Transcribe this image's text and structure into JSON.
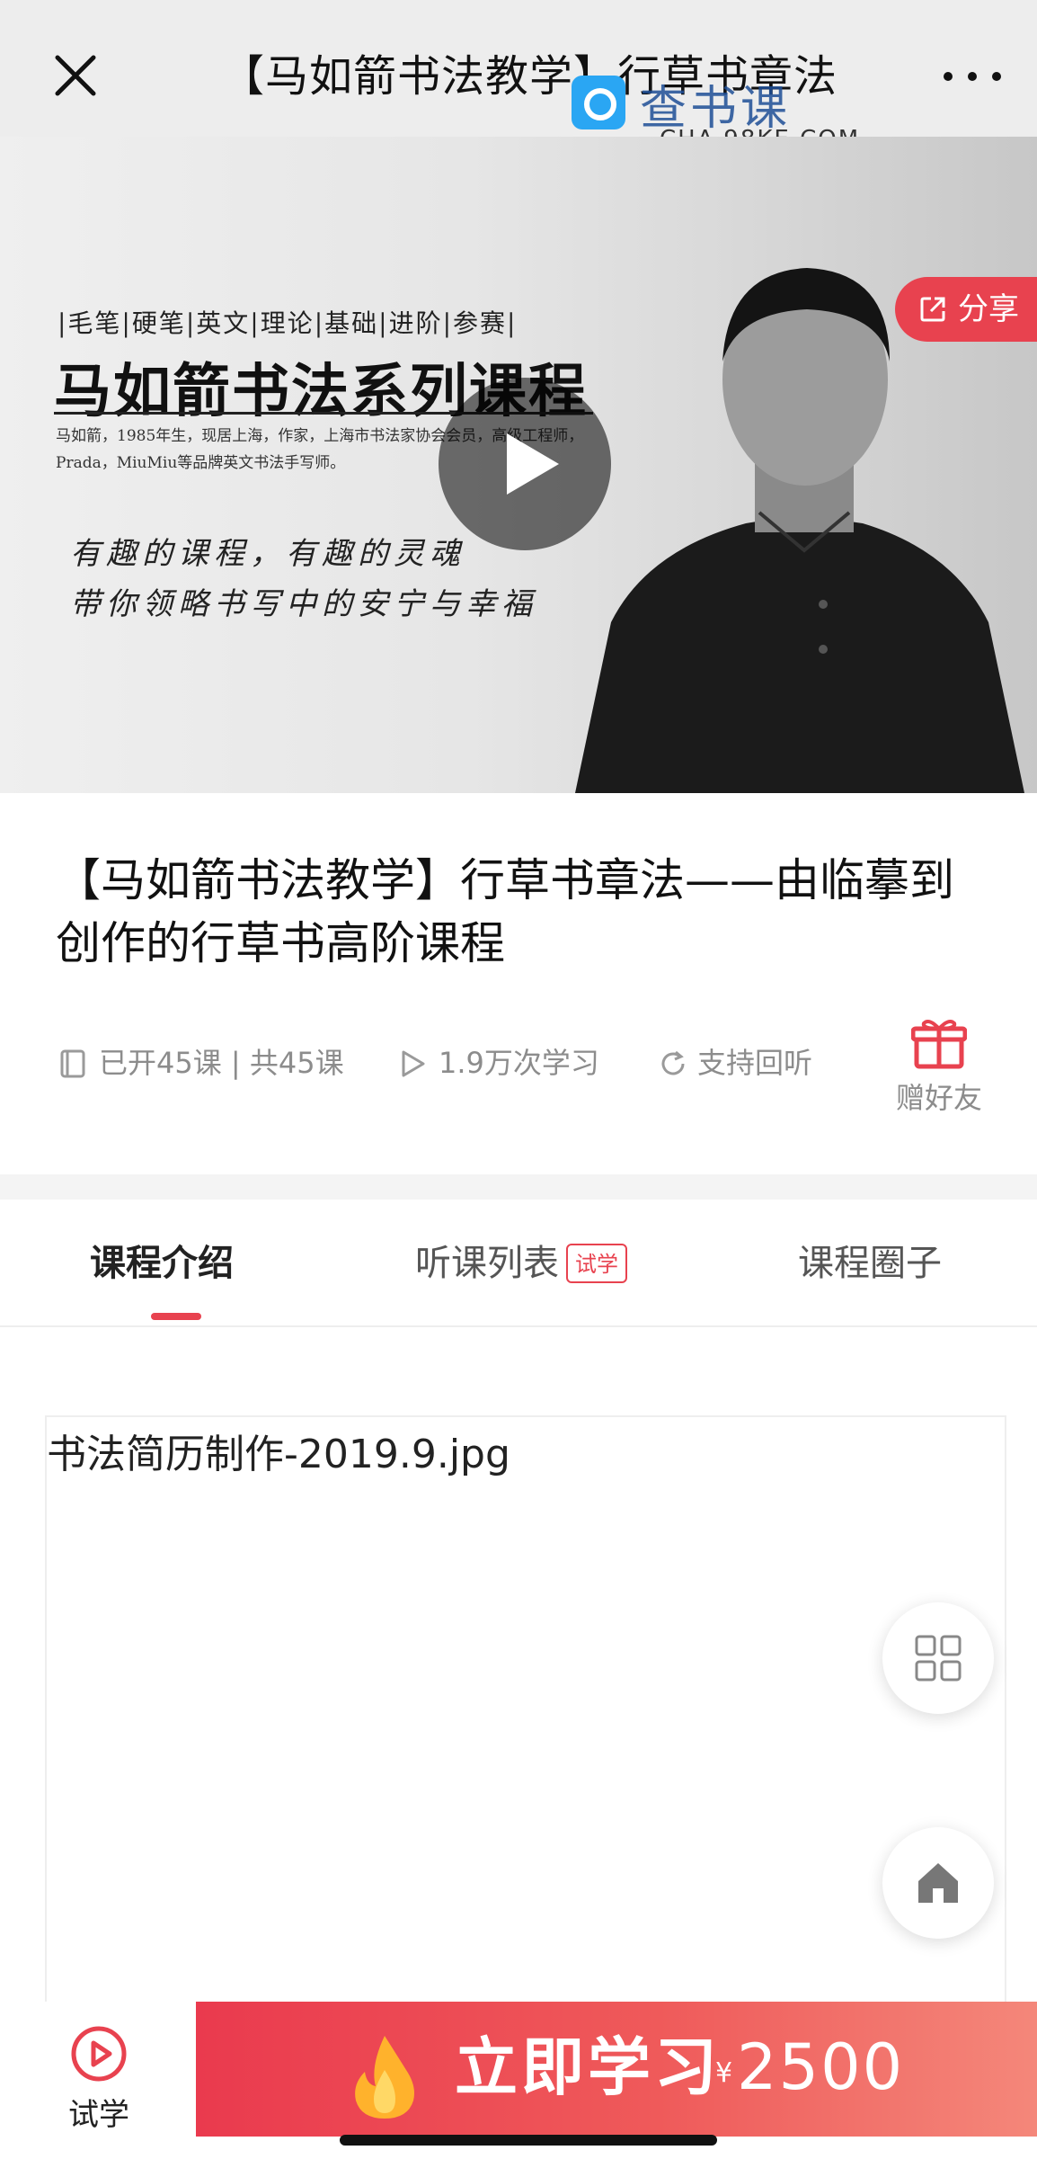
{
  "header": {
    "title": "【马如箭书法教学】行草书章法",
    "watermark_text": "查书课",
    "watermark_sub": "CHA.98KE.COM"
  },
  "hero": {
    "tags": "|毛笔|硬笔|英文|理论|基础|进阶|参赛|",
    "series_title": "马如箭书法系列课程",
    "bio": "马如箭，1985年生，现居上海，作家，上海市书法家协会会员，高级工程师，Prada，MiuMiu等品牌英文书法手写师。",
    "handwriting_line1": "有趣的课程，有趣的灵魂",
    "handwriting_line2": "带你领略书写中的安宁与幸福",
    "share_label": "分享"
  },
  "course": {
    "title": "【马如箭书法教学】行草书章法——由临摹到创作的行草书高阶课程",
    "lessons": "已开45课 | 共45课",
    "views": "1.9万次学习",
    "replay": "支持回听",
    "gift_label": "赠好友"
  },
  "tabs": [
    {
      "label": "课程介绍",
      "active": true
    },
    {
      "label": "听课列表",
      "badge": "试学"
    },
    {
      "label": "课程圈子"
    }
  ],
  "content": {
    "image_alt": "书法简历制作-2019.9.jpg"
  },
  "bottom_bar": {
    "trial_label": "试学",
    "buy_label": "立即学习",
    "currency": "¥",
    "price": "2500"
  },
  "colors": {
    "accent": "#e8424f",
    "meta_gray": "#8c8c8c",
    "header_bg": "#ededed"
  },
  "icons": [
    "close-icon",
    "more-icon",
    "play-icon",
    "share-icon",
    "book-icon",
    "play-outline-icon",
    "replay-icon",
    "gift-icon",
    "grid-icon",
    "home-icon",
    "play-circle-icon",
    "flame-icon"
  ]
}
